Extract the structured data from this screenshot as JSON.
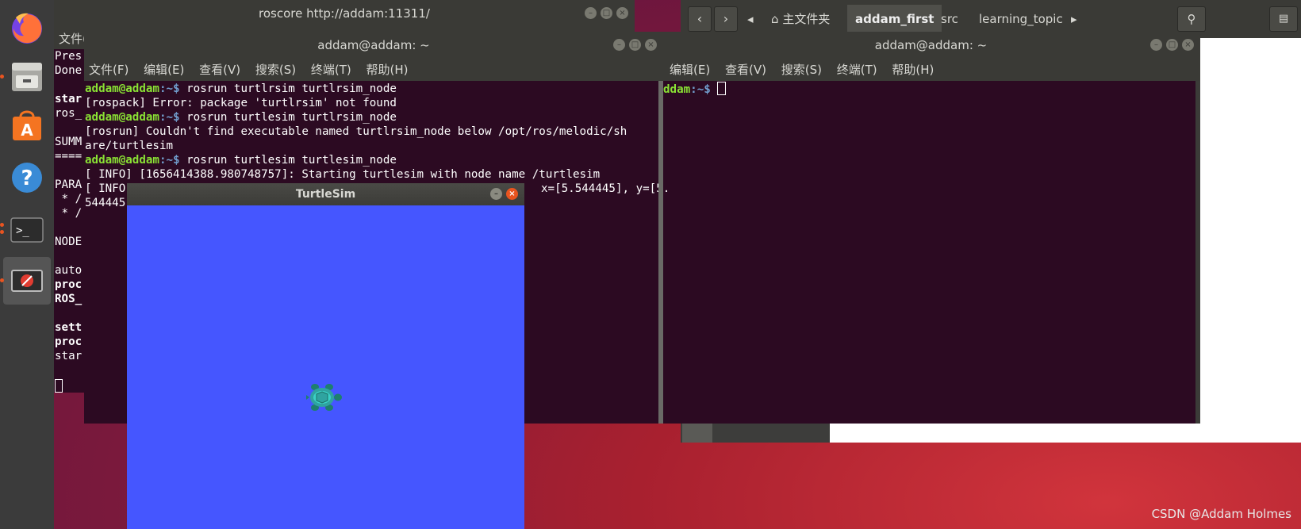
{
  "dock": {
    "items": [
      {
        "name": "firefox"
      },
      {
        "name": "files"
      },
      {
        "name": "software-center"
      },
      {
        "name": "help"
      },
      {
        "name": "terminal"
      },
      {
        "name": "turtlesim-app"
      }
    ]
  },
  "roscore_window": {
    "title": "roscore http://addam:11311/",
    "menu_partial": "文件(",
    "lines": [
      "Pres",
      "Done",
      "",
      "star",
      "ros_",
      "",
      "SUMM",
      "====",
      "",
      "PARA",
      " * /",
      " * /",
      "",
      "NODE",
      "",
      "auto",
      "proc",
      "ROS_",
      "",
      "sett",
      "proc",
      "star"
    ]
  },
  "terminal1": {
    "title": "addam@addam: ~",
    "menu": [
      "文件(F)",
      "编辑(E)",
      "查看(V)",
      "搜索(S)",
      "终端(T)",
      "帮助(H)"
    ],
    "prompt_user": "addam@addam",
    "prompt_path": ":~$",
    "cmd1": " rosrun turtlrsim turtlrsim_node",
    "out1": "[rospack] Error: package 'turtlrsim' not found",
    "cmd2": " rosrun turtlesim turtlrsim_node",
    "out2a": "[rosrun] Couldn't find executable named turtlrsim_node below /opt/ros/melodic/sh",
    "out2b": "are/turtlesim",
    "cmd3": " rosrun turtlesim turtlesim_node",
    "out3": "[ INFO] [1656414388.980748757]: Starting turtlesim with node name /turtlesim",
    "out4_left": "[ INFO",
    "out4_right": "x=[5.544445], y=[5.",
    "out5": "544445"
  },
  "terminal2": {
    "title": "addam@addam: ~",
    "menu": [
      "编辑(E)",
      "查看(V)",
      "搜索(S)",
      "终端(T)",
      "帮助(H)"
    ],
    "prompt_user": "ddam",
    "prompt_path": ":~$"
  },
  "file_manager": {
    "home_label": "主文件夹",
    "crumbs": [
      "addam_first",
      "src",
      "learning_topic"
    ]
  },
  "turtlesim": {
    "title": "TurtleSim",
    "background_color": "#4556ff"
  },
  "watermark": "CSDN @Addam Holmes"
}
